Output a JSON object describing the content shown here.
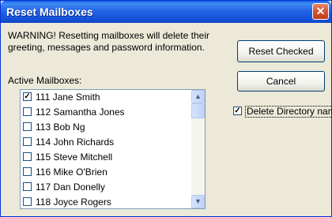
{
  "dialog": {
    "title": "Reset Mailboxes",
    "close_glyph": "✕",
    "warning_text": "WARNING! Resetting mailboxes will delete their greeting, messages and password information.",
    "reset_button_label": "Reset Checked",
    "cancel_button_label": "Cancel",
    "list_label": "Active Mailboxes:",
    "mailboxes": [
      {
        "label": "111 Jane Smith",
        "checked": true
      },
      {
        "label": "112 Samantha Jones",
        "checked": false
      },
      {
        "label": "113 Bob Ng",
        "checked": false
      },
      {
        "label": "114 John Richards",
        "checked": false
      },
      {
        "label": "115 Steve Mitchell",
        "checked": false
      },
      {
        "label": "116 Mike O'Brien",
        "checked": false
      },
      {
        "label": "117 Dan Donelly",
        "checked": false
      },
      {
        "label": "118 Joyce Rogers",
        "checked": false
      }
    ],
    "delete_directory_option": {
      "label": "Delete Directory name",
      "checked": true
    },
    "scroll_up_glyph": "▲",
    "scroll_down_glyph": "▼",
    "check_glyph": "✓"
  }
}
